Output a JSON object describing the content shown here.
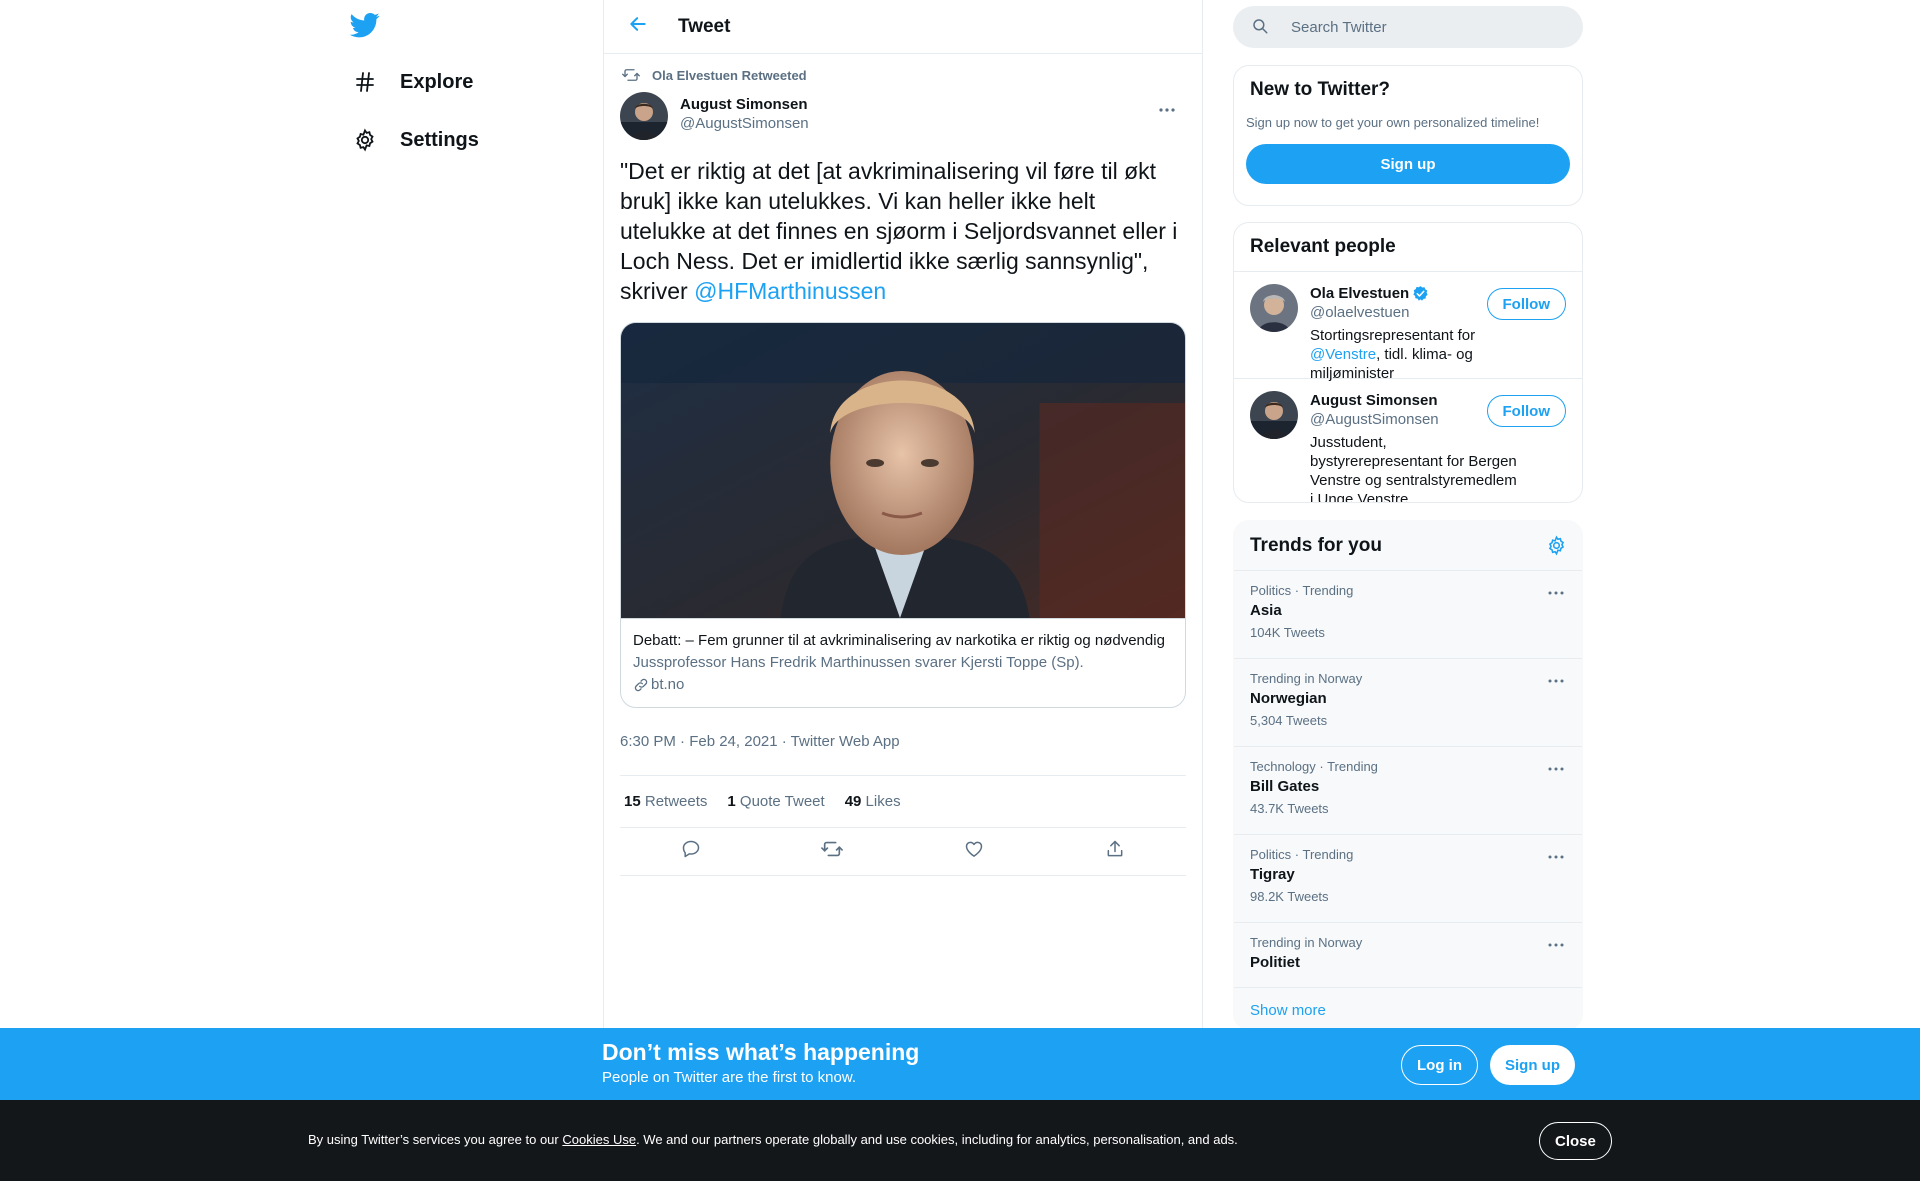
{
  "colors": {
    "accent": "#1da1f2",
    "secondary_text": "#5b7083",
    "cookie_bar": "#14171a"
  },
  "nav": {
    "logo_icon": "twitter-bird-icon",
    "items": [
      {
        "label": "Explore",
        "icon": "hashtag-icon"
      },
      {
        "label": "Settings",
        "icon": "gear-icon"
      }
    ]
  },
  "header": {
    "title": "Tweet",
    "back_icon": "arrow-left-icon"
  },
  "tweet": {
    "retweeted_by": "Ola Elvestuen Retweeted",
    "author_name": "August Simonsen",
    "author_handle": "@AugustSimonsen",
    "text": "\"Det er riktig at det [at avkriminalisering vil føre til økt bruk] ikke kan utelukkes. Vi kan heller ikke helt utelukke at det finnes en sjøorm i Seljordsvannet eller i Loch Ness. Det er imidlertid ikke særlig sannsynlig\", skriver ",
    "mention": "@HFMarthinussen",
    "card": {
      "title": "Debatt: – Fem grunner til at avkriminalisering av narkotika er riktig og nødvendig",
      "description": "Jussprofessor Hans Fredrik Marthinussen svarer Kjersti Toppe (Sp).",
      "domain": "bt.no"
    },
    "timestamp": "6:30 PM · Feb 24, 2021 · Twitter Web App",
    "stats": {
      "retweets_count": "15",
      "retweets_label": "Retweets",
      "quotes_count": "1",
      "quotes_label": "Quote Tweet",
      "likes_count": "49",
      "likes_label": "Likes"
    },
    "actions": [
      "reply-icon",
      "retweet-icon",
      "like-icon",
      "share-icon"
    ]
  },
  "search": {
    "placeholder": "Search Twitter"
  },
  "new_to_twitter": {
    "title": "New to Twitter?",
    "subtitle": "Sign up now to get your own personalized timeline!",
    "button": "Sign up"
  },
  "relevant_people": {
    "title": "Relevant people",
    "people": [
      {
        "name": "Ola Elvestuen",
        "handle": "@olaelvestuen",
        "verified": true,
        "bio_prefix": "Stortingsrepresentant for ",
        "bio_mention": "@Venstre",
        "bio_suffix": ", tidl. klima- og miljøminister",
        "follow": "Follow"
      },
      {
        "name": "August Simonsen",
        "handle": "@AugustSimonsen",
        "verified": false,
        "bio_prefix": "Jusstudent, bystyrerepresentant for Bergen Venstre og sentralstyremedlem i Unge Venstre.",
        "bio_mention": "",
        "bio_suffix": "",
        "follow": "Follow"
      }
    ]
  },
  "trends": {
    "title": "Trends for you",
    "items": [
      {
        "context": "Politics · Trending",
        "name": "Asia",
        "count": "104K Tweets"
      },
      {
        "context": "Trending in Norway",
        "name": "Norwegian",
        "count": "5,304 Tweets"
      },
      {
        "context": "Technology · Trending",
        "name": "Bill Gates",
        "count": "43.7K Tweets"
      },
      {
        "context": "Politics · Trending",
        "name": "Tigray",
        "count": "98.2K Tweets"
      },
      {
        "context": "Trending in Norway",
        "name": "Politiet",
        "count": ""
      }
    ],
    "show_more": "Show more"
  },
  "banner": {
    "title": "Don’t miss what’s happening",
    "subtitle": "People on Twitter are the first to know.",
    "login": "Log in",
    "signup": "Sign up"
  },
  "cookie": {
    "prefix": "By using Twitter’s services you agree to our ",
    "link": "Cookies Use",
    "suffix": ". We and our partners operate globally and use cookies, including for analytics, personalisation, and ads.",
    "close": "Close"
  }
}
